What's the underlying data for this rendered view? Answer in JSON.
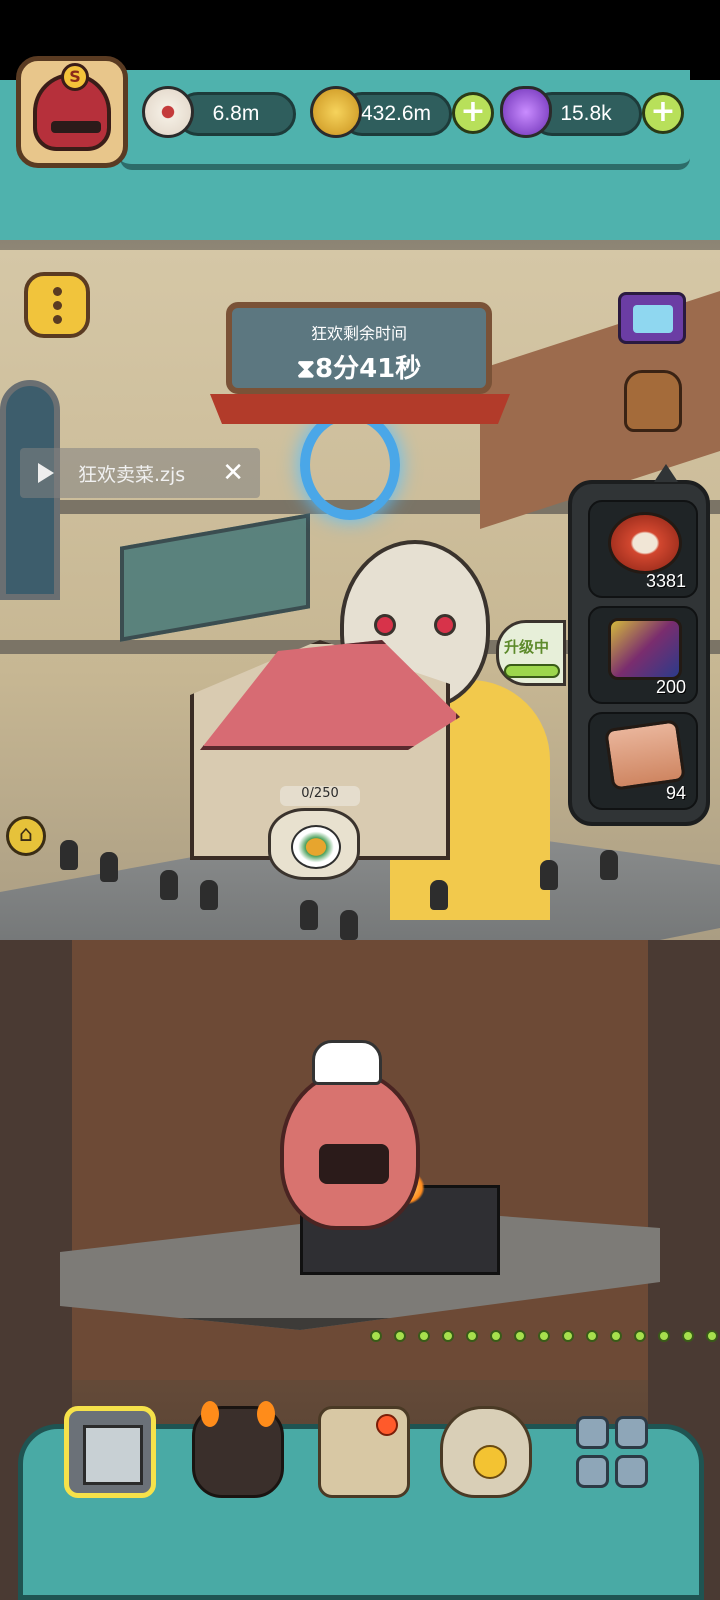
{
  "hud": {
    "eyes": "6.8m",
    "coins": "432.6m",
    "potions": "15.8k",
    "avatar_letter": "S"
  },
  "event": {
    "title": "狂欢剩余时间",
    "time_left": "8分41秒"
  },
  "overlay": {
    "label": "狂欢卖菜.zjs",
    "close": "✕"
  },
  "restaurant": {
    "progress": "0/250",
    "upgrade_label": "升级中"
  },
  "inventory": [
    {
      "icon": "meat-icon",
      "count": "3381"
    },
    {
      "icon": "mech-icon",
      "count": "200"
    },
    {
      "icon": "scroll-icon",
      "count": "94"
    }
  ],
  "nav": {
    "items": [
      "shop-icon",
      "fire-monster-icon",
      "book-icon",
      "money-bag-icon",
      "grid-icon"
    ]
  },
  "colors": {
    "hud_teal": "#4fb2ad",
    "plus_green": "#b8e05a",
    "highlight_yellow": "#f6e24a"
  }
}
